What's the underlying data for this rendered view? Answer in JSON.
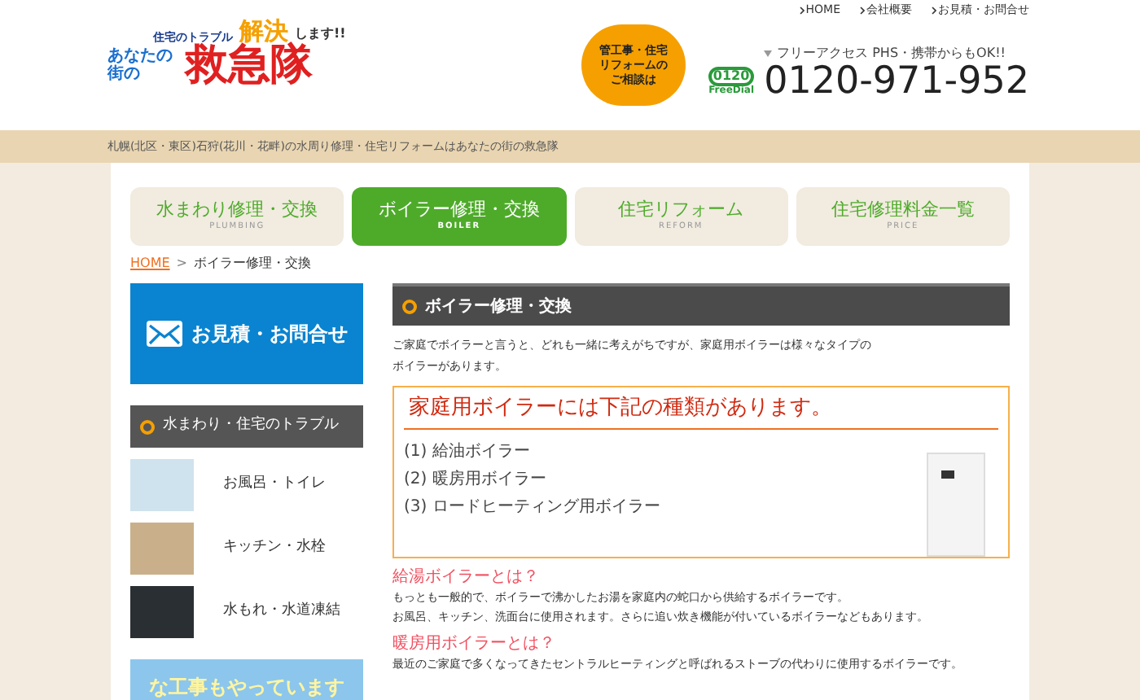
{
  "top_links": [
    "HOME",
    "会社概要",
    "お見積・お問合せ"
  ],
  "logo": {
    "tagline": "住宅のトラブル",
    "highlight": "解決",
    "suffix": "します!!",
    "sub": "あなたの街の",
    "name": "救急隊"
  },
  "bubble": "管工事・住宅リフォームのご相談は",
  "contact": {
    "note": "フリーアクセス PHS・携帯からもOK!!",
    "badge_number": "0120",
    "badge_label": "FreeDial",
    "phone": "0120-971-952"
  },
  "site_description": "札幌(北区・東区)石狩(花川・花畔)の水周り修理・住宅リフォームはあなたの街の救急隊",
  "tabs": [
    {
      "label": "水まわり修理・交換",
      "sub": "PLUMBING",
      "selected": false
    },
    {
      "label": "ボイラー修理・交換",
      "sub": "BOILER",
      "selected": true
    },
    {
      "label": "住宅リフォーム",
      "sub": "REFORM",
      "selected": false
    },
    {
      "label": "住宅修理料金一覧",
      "sub": "PRICE",
      "selected": false
    }
  ],
  "breadcrumb": {
    "home": "HOME",
    "separator": ">",
    "current": "ボイラー修理・交換"
  },
  "sidebar": {
    "contact_button": "お見積・お問合せ",
    "section_title": "水まわり・住宅のトラブル",
    "items": [
      {
        "label": "お風呂・トイレ"
      },
      {
        "label": "キッチン・水栓"
      },
      {
        "label": "水もれ・水道凍結"
      }
    ],
    "banner": "な工事もやっています"
  },
  "main": {
    "title": "ボイラー修理・交換",
    "intro": [
      "ご家庭でボイラーと言うと、どれも一緒に考えがちですが、家庭用ボイラーは様々なタイプの",
      "ボイラーがあります。"
    ],
    "box_title": "家庭用ボイラーには下記の種類があります。",
    "types": [
      "(1) 給油ボイラー",
      "(2) 暖房用ボイラー",
      "(3) ロードヒーティング用ボイラー"
    ],
    "sections": [
      {
        "heading": "給湯ボイラーとは？",
        "lines": [
          "もっとも一般的で、ボイラーで沸かしたお湯を家庭内の蛇口から供給するボイラーです。",
          "お風呂、キッチン、洗面台に使用されます。さらに追い炊き機能が付いているボイラーなどもあります。"
        ]
      },
      {
        "heading": "暖房用ボイラーとは？",
        "lines": [
          "最近のご家庭で多くなってきたセントラルヒーティングと呼ばれるストーブの代わりに使用するボイラーです。"
        ]
      }
    ]
  }
}
